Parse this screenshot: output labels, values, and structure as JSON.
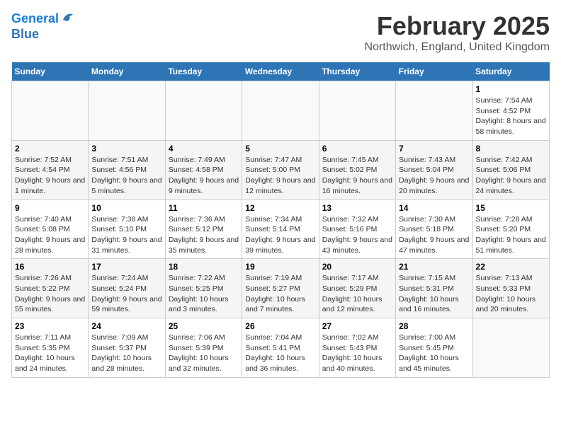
{
  "logo": {
    "line1": "General",
    "line2": "Blue"
  },
  "title": "February 2025",
  "location": "Northwich, England, United Kingdom",
  "days_of_week": [
    "Sunday",
    "Monday",
    "Tuesday",
    "Wednesday",
    "Thursday",
    "Friday",
    "Saturday"
  ],
  "weeks": [
    [
      {
        "day": "",
        "info": ""
      },
      {
        "day": "",
        "info": ""
      },
      {
        "day": "",
        "info": ""
      },
      {
        "day": "",
        "info": ""
      },
      {
        "day": "",
        "info": ""
      },
      {
        "day": "",
        "info": ""
      },
      {
        "day": "1",
        "info": "Sunrise: 7:54 AM\nSunset: 4:52 PM\nDaylight: 8 hours and 58 minutes."
      }
    ],
    [
      {
        "day": "2",
        "info": "Sunrise: 7:52 AM\nSunset: 4:54 PM\nDaylight: 9 hours and 1 minute."
      },
      {
        "day": "3",
        "info": "Sunrise: 7:51 AM\nSunset: 4:56 PM\nDaylight: 9 hours and 5 minutes."
      },
      {
        "day": "4",
        "info": "Sunrise: 7:49 AM\nSunset: 4:58 PM\nDaylight: 9 hours and 9 minutes."
      },
      {
        "day": "5",
        "info": "Sunrise: 7:47 AM\nSunset: 5:00 PM\nDaylight: 9 hours and 12 minutes."
      },
      {
        "day": "6",
        "info": "Sunrise: 7:45 AM\nSunset: 5:02 PM\nDaylight: 9 hours and 16 minutes."
      },
      {
        "day": "7",
        "info": "Sunrise: 7:43 AM\nSunset: 5:04 PM\nDaylight: 9 hours and 20 minutes."
      },
      {
        "day": "8",
        "info": "Sunrise: 7:42 AM\nSunset: 5:06 PM\nDaylight: 9 hours and 24 minutes."
      }
    ],
    [
      {
        "day": "9",
        "info": "Sunrise: 7:40 AM\nSunset: 5:08 PM\nDaylight: 9 hours and 28 minutes."
      },
      {
        "day": "10",
        "info": "Sunrise: 7:38 AM\nSunset: 5:10 PM\nDaylight: 9 hours and 31 minutes."
      },
      {
        "day": "11",
        "info": "Sunrise: 7:36 AM\nSunset: 5:12 PM\nDaylight: 9 hours and 35 minutes."
      },
      {
        "day": "12",
        "info": "Sunrise: 7:34 AM\nSunset: 5:14 PM\nDaylight: 9 hours and 39 minutes."
      },
      {
        "day": "13",
        "info": "Sunrise: 7:32 AM\nSunset: 5:16 PM\nDaylight: 9 hours and 43 minutes."
      },
      {
        "day": "14",
        "info": "Sunrise: 7:30 AM\nSunset: 5:18 PM\nDaylight: 9 hours and 47 minutes."
      },
      {
        "day": "15",
        "info": "Sunrise: 7:28 AM\nSunset: 5:20 PM\nDaylight: 9 hours and 51 minutes."
      }
    ],
    [
      {
        "day": "16",
        "info": "Sunrise: 7:26 AM\nSunset: 5:22 PM\nDaylight: 9 hours and 55 minutes."
      },
      {
        "day": "17",
        "info": "Sunrise: 7:24 AM\nSunset: 5:24 PM\nDaylight: 9 hours and 59 minutes."
      },
      {
        "day": "18",
        "info": "Sunrise: 7:22 AM\nSunset: 5:25 PM\nDaylight: 10 hours and 3 minutes."
      },
      {
        "day": "19",
        "info": "Sunrise: 7:19 AM\nSunset: 5:27 PM\nDaylight: 10 hours and 7 minutes."
      },
      {
        "day": "20",
        "info": "Sunrise: 7:17 AM\nSunset: 5:29 PM\nDaylight: 10 hours and 12 minutes."
      },
      {
        "day": "21",
        "info": "Sunrise: 7:15 AM\nSunset: 5:31 PM\nDaylight: 10 hours and 16 minutes."
      },
      {
        "day": "22",
        "info": "Sunrise: 7:13 AM\nSunset: 5:33 PM\nDaylight: 10 hours and 20 minutes."
      }
    ],
    [
      {
        "day": "23",
        "info": "Sunrise: 7:11 AM\nSunset: 5:35 PM\nDaylight: 10 hours and 24 minutes."
      },
      {
        "day": "24",
        "info": "Sunrise: 7:09 AM\nSunset: 5:37 PM\nDaylight: 10 hours and 28 minutes."
      },
      {
        "day": "25",
        "info": "Sunrise: 7:06 AM\nSunset: 5:39 PM\nDaylight: 10 hours and 32 minutes."
      },
      {
        "day": "26",
        "info": "Sunrise: 7:04 AM\nSunset: 5:41 PM\nDaylight: 10 hours and 36 minutes."
      },
      {
        "day": "27",
        "info": "Sunrise: 7:02 AM\nSunset: 5:43 PM\nDaylight: 10 hours and 40 minutes."
      },
      {
        "day": "28",
        "info": "Sunrise: 7:00 AM\nSunset: 5:45 PM\nDaylight: 10 hours and 45 minutes."
      },
      {
        "day": "",
        "info": ""
      }
    ]
  ]
}
